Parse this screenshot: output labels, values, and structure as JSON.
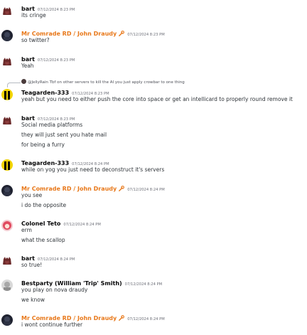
{
  "colors": {
    "mod_name": "#e8781a",
    "text": "#2e3338",
    "timestamp": "#6d6f78"
  },
  "messages": [
    {
      "author": "bart",
      "timestamp": "07/12/2024 8:23 PM",
      "avatar": "bart-avatar",
      "lines": [
        "its cringe"
      ]
    },
    {
      "author": "Mr Comrade RD / John Draudy",
      "timestamp": "07/12/2024 8:23 PM",
      "avatar": "comrade-avatar",
      "badge": "wrench-icon",
      "lines": [
        "so twitter?"
      ]
    },
    {
      "author": "bart",
      "timestamp": "07/12/2024 8:23 PM",
      "avatar": "bart-avatar",
      "lines": [
        "Yeah"
      ]
    },
    {
      "author": "Teagarden-333",
      "timestamp": "07/12/2024 8:23 PM",
      "avatar": "teagarden-avatar",
      "reply": "@JellyRain Tbf on other servers to kill the AI you just apply crowbar to one thing",
      "lines": [
        "yeah but you need to either push the core into space or get an intellicard to properly round remove it"
      ]
    },
    {
      "author": "bart",
      "timestamp": "07/12/2024 8:23 PM",
      "avatar": "bart-avatar",
      "lines": [
        "Social media platforms",
        "they will just sent you hate mail",
        "for being a furry"
      ]
    },
    {
      "author": "Teagarden-333",
      "timestamp": "07/12/2024 8:24 PM",
      "avatar": "teagarden-avatar",
      "lines": [
        "while on yog you just need to deconstruct it's servers"
      ]
    },
    {
      "author": "Mr Comrade RD / John Draudy",
      "timestamp": "07/12/2024 8:24 PM",
      "avatar": "comrade-avatar",
      "badge": "wrench-icon",
      "lines": [
        "you see",
        "i do the opposite"
      ]
    },
    {
      "author": "Colonel Teto",
      "timestamp": "07/12/2024 8:24 PM",
      "avatar": "teto-avatar",
      "lines": [
        "erm",
        "what the scallop"
      ]
    },
    {
      "author": "bart",
      "timestamp": "07/12/2024 8:24 PM",
      "avatar": "bart-avatar",
      "lines": [
        "so true!"
      ]
    },
    {
      "author": "Bestparty (William 'Trip' Smith)",
      "timestamp": "07/12/2024 8:24 PM",
      "avatar": "bestparty-avatar",
      "lines": [
        "you play on nova draudy",
        "we know"
      ]
    },
    {
      "author": "Mr Comrade RD / John Draudy",
      "timestamp": "07/12/2024 8:24 PM",
      "avatar": "comrade-avatar",
      "badge": "wrench-icon",
      "lines": [
        "i wont continue further"
      ]
    }
  ]
}
